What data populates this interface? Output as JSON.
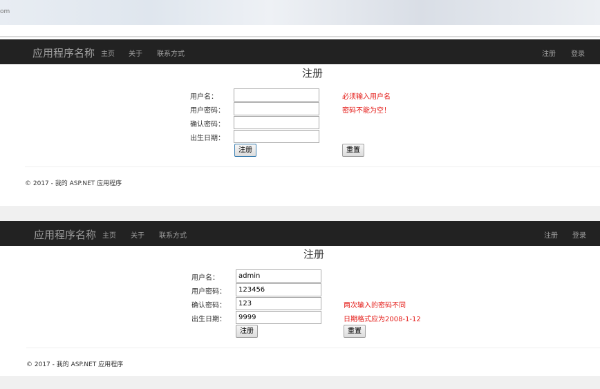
{
  "browser": {
    "tab_text": "om"
  },
  "screens": [
    {
      "navbar": {
        "brand": "应用程序名称",
        "links": [
          "主页",
          "关于",
          "联系方式"
        ],
        "right_links": [
          "注册",
          "登录"
        ]
      },
      "heading": "注册",
      "form": {
        "username_label": "用户名：",
        "username_value": "",
        "password_label": "用户密码：",
        "password_value": "",
        "confirm_label": "确认密码：",
        "confirm_value": "",
        "birthday_label": "出生日期：",
        "birthday_value": "",
        "submit_label": "注册",
        "reset_label": "重置"
      },
      "errors": {
        "username": "必须输入用户名",
        "password": "密码不能为空！",
        "confirm": "",
        "birthday": ""
      },
      "footer": "© 2017 - 我的 ASP.NET 应用程序"
    },
    {
      "navbar": {
        "brand": "应用程序名称",
        "links": [
          "主页",
          "关于",
          "联系方式"
        ],
        "right_links": [
          "注册",
          "登录"
        ]
      },
      "heading": "注册",
      "form": {
        "username_label": "用户名：",
        "username_value": "admin",
        "password_label": "用户密码：",
        "password_value": "123456",
        "confirm_label": "确认密码：",
        "confirm_value": "123",
        "birthday_label": "出生日期：",
        "birthday_value": "9999",
        "submit_label": "注册",
        "reset_label": "重置"
      },
      "errors": {
        "username": "",
        "password": "",
        "confirm": "两次输入的密码不同",
        "birthday": "日期格式应为2008-1-12"
      },
      "footer": "© 2017 - 我的 ASP.NET 应用程序"
    }
  ],
  "colors": {
    "navbar_bg": "#222222",
    "nav_text": "#9d9d9d",
    "error_text": "#e41b17",
    "gap_band": "#f0f0f0"
  }
}
